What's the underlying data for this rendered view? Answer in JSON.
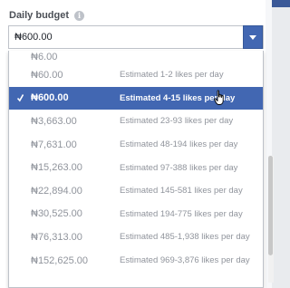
{
  "budget": {
    "label": "Daily budget",
    "info_icon": "info-icon",
    "selected_value": "₦600.00",
    "caret_icon": "caret-down-icon"
  },
  "options": [
    {
      "amount": "₦6.00",
      "estimate": "",
      "selected": false
    },
    {
      "amount": "₦60.00",
      "estimate": "Estimated 1-2 likes per day",
      "selected": false
    },
    {
      "amount": "₦600.00",
      "estimate": "Estimated 4-15 likes per day",
      "selected": true
    },
    {
      "amount": "₦3,663.00",
      "estimate": "Estimated 23-93 likes per day",
      "selected": false
    },
    {
      "amount": "₦7,631.00",
      "estimate": "Estimated 48-194 likes per day",
      "selected": false
    },
    {
      "amount": "₦15,263.00",
      "estimate": "Estimated 97-388 likes per day",
      "selected": false
    },
    {
      "amount": "₦22,894.00",
      "estimate": "Estimated 145-581 likes per day",
      "selected": false
    },
    {
      "amount": "₦30,525.00",
      "estimate": "Estimated 194-775 likes per day",
      "selected": false
    },
    {
      "amount": "₦76,313.00",
      "estimate": "Estimated 485-1,938 likes per day",
      "selected": false
    },
    {
      "amount": "₦152,625.00",
      "estimate": "Estimated 969-3,876 likes per day",
      "selected": false
    }
  ],
  "colors": {
    "accent": "#4267b2",
    "muted_text": "#90949c",
    "border": "#bec2c9"
  }
}
